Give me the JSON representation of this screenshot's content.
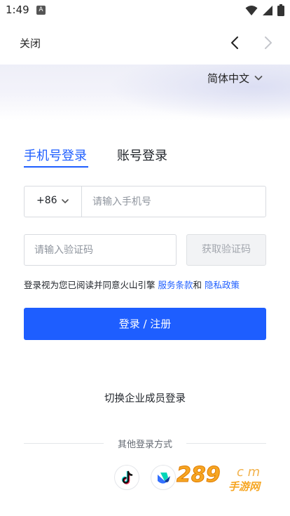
{
  "status_bar": {
    "time": "1:49",
    "notification_badge": "A"
  },
  "nav": {
    "close_label": "关闭"
  },
  "language": {
    "label": "简体中文"
  },
  "tabs": {
    "phone_login": "手机号登录",
    "account_login": "账号登录"
  },
  "phone": {
    "country_code": "+86",
    "placeholder": "请输入手机号"
  },
  "verify": {
    "placeholder": "请输入验证码",
    "get_code_label": "获取验证码"
  },
  "agreement": {
    "prefix": "登录视为您已阅读并同意火山引擎",
    "terms": "服务条款",
    "and": "和",
    "privacy": "隐私政策"
  },
  "login_button": "登录 / 注册",
  "switch_enterprise": "切换企业成员登录",
  "other_methods_label": "其他登录方式",
  "watermark": {
    "number": "289",
    "suffix": "c m",
    "sub": "手游网"
  },
  "colors": {
    "accent": "#1e5eff",
    "text": "#1f2329",
    "placeholder": "#8f959e",
    "border": "#d8dbe0"
  },
  "icons": [
    "wifi-icon",
    "signal-icon",
    "battery-icon",
    "back-chevron-icon",
    "forward-chevron-icon",
    "chevron-down-icon",
    "douyin-icon",
    "feishu-icon"
  ]
}
